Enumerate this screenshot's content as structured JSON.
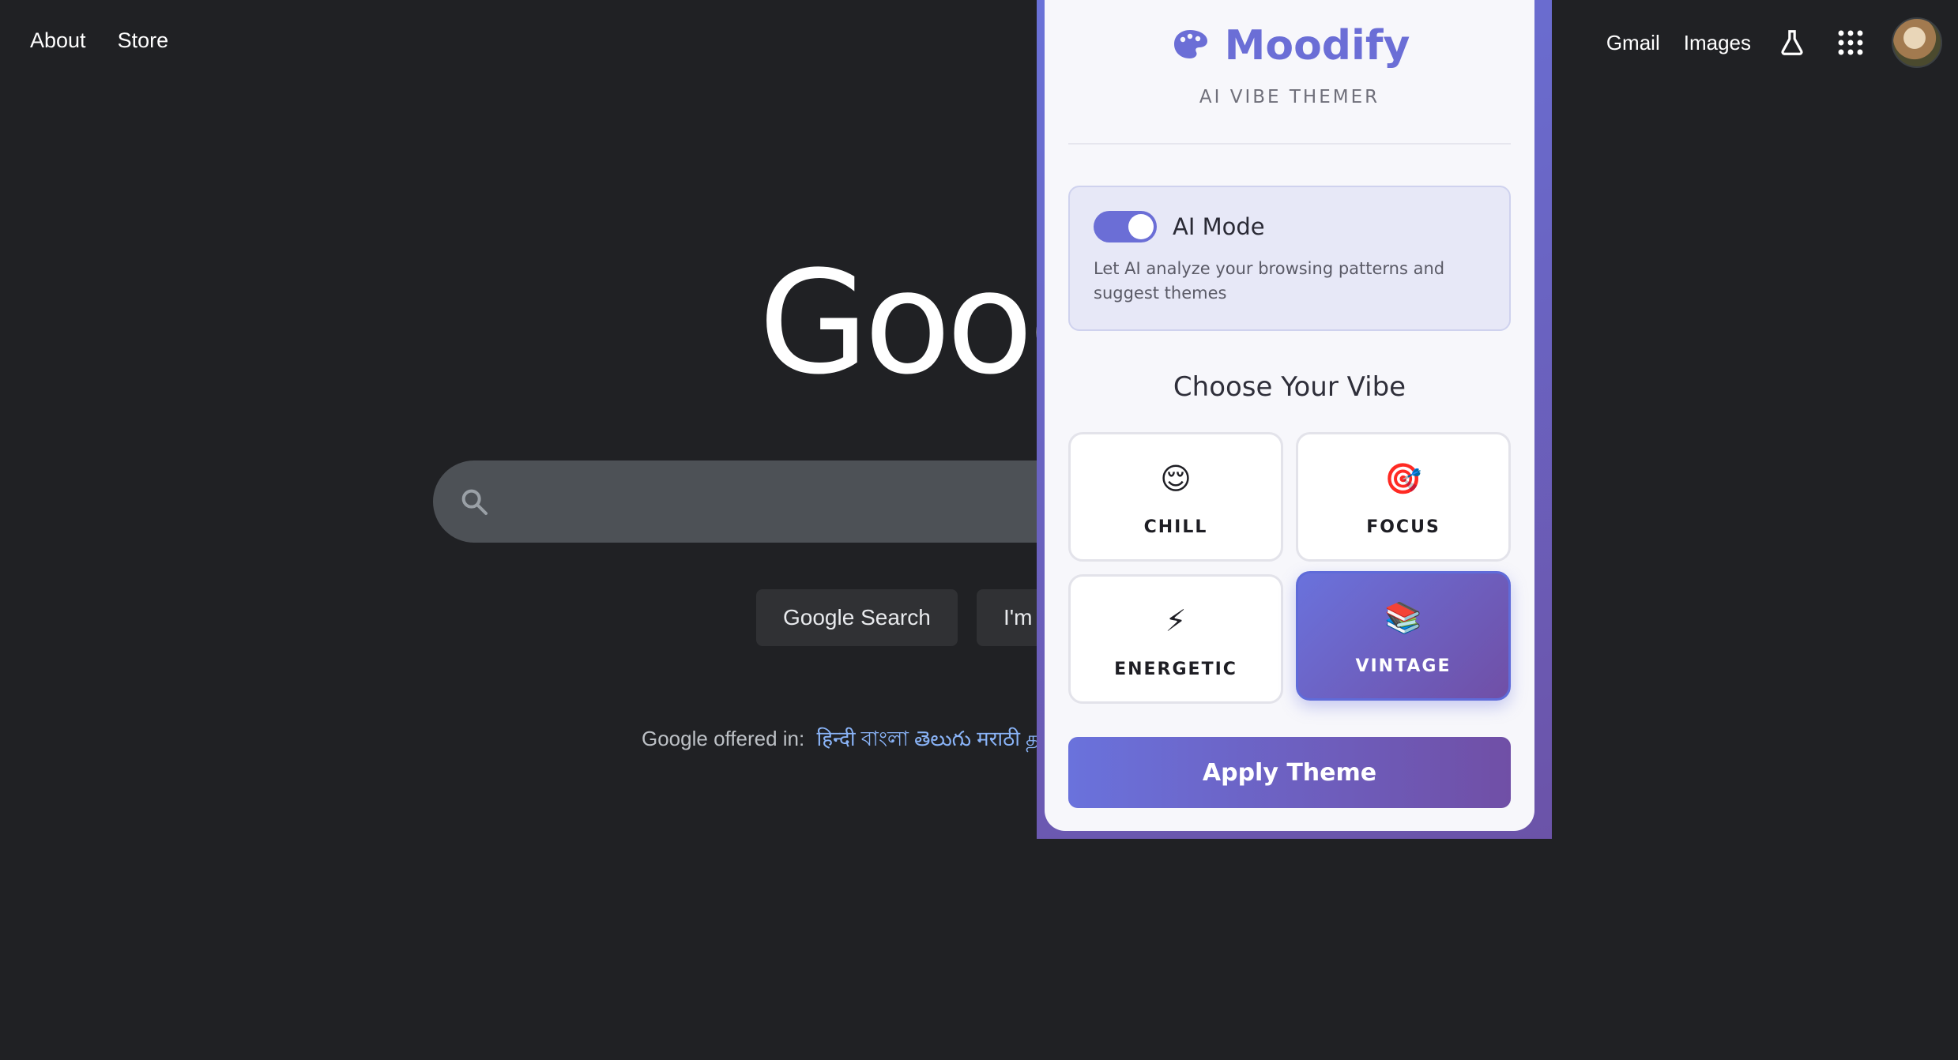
{
  "google": {
    "nav_left": [
      "About",
      "Store"
    ],
    "nav_right": {
      "gmail": "Gmail",
      "images": "Images"
    },
    "logo_text": "Goog",
    "buttons": {
      "search": "Google Search",
      "lucky": "I'm"
    },
    "offered_label": "Google offered in:",
    "offered_langs": "हिन्दी বাংলা తెలుగు मराठी த"
  },
  "popup": {
    "brand": "Moodify",
    "subtitle": "AI VIBE THEMER",
    "ai_mode": {
      "title": "AI Mode",
      "description": "Let AI analyze your browsing patterns and suggest themes",
      "enabled": true
    },
    "vibe_heading": "Choose Your Vibe",
    "vibes": [
      {
        "emoji": "😌",
        "label": "CHILL",
        "selected": false
      },
      {
        "emoji": "🎯",
        "label": "FOCUS",
        "selected": false
      },
      {
        "emoji": "⚡",
        "label": "ENERGETIC",
        "selected": false
      },
      {
        "emoji": "📚",
        "label": "VINTAGE",
        "selected": true
      }
    ],
    "apply_label": "Apply Theme",
    "accent_color": "#6b6ed6"
  }
}
